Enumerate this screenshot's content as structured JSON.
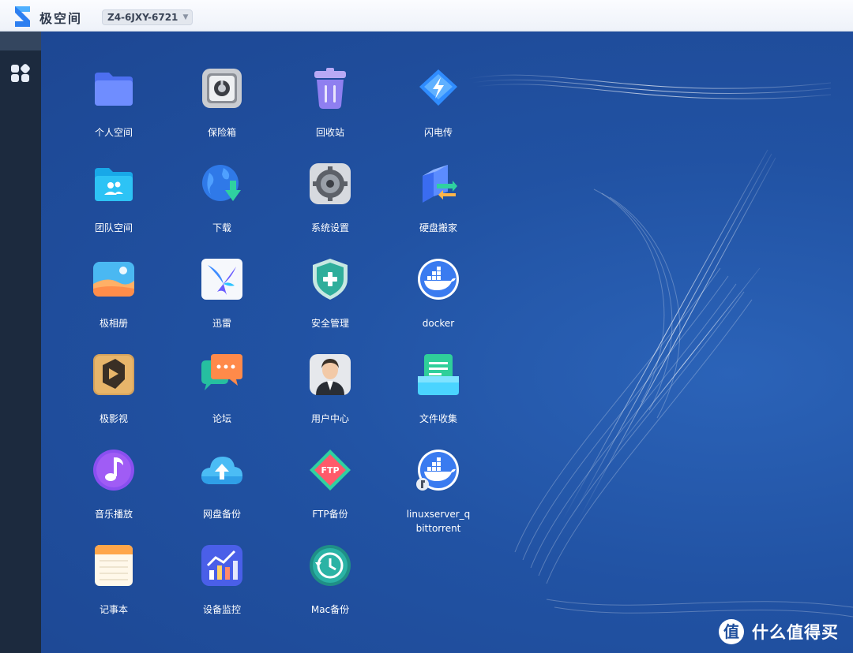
{
  "header": {
    "brand": "极空间",
    "device": "Z4-6JXY-6721"
  },
  "apps": [
    {
      "label": "个人空间",
      "icon": "folder-icon"
    },
    {
      "label": "保险箱",
      "icon": "safe-icon"
    },
    {
      "label": "回收站",
      "icon": "trash-icon"
    },
    {
      "label": "闪电传",
      "icon": "lightning-icon"
    },
    {
      "label": "团队空间",
      "icon": "team-folder-icon"
    },
    {
      "label": "下载",
      "icon": "download-globe-icon"
    },
    {
      "label": "系统设置",
      "icon": "settings-gear-icon"
    },
    {
      "label": "硬盘搬家",
      "icon": "disk-migrate-icon"
    },
    {
      "label": "极相册",
      "icon": "photo-album-icon"
    },
    {
      "label": "迅雷",
      "icon": "xunlei-bird-icon"
    },
    {
      "label": "安全管理",
      "icon": "shield-plus-icon"
    },
    {
      "label": "docker",
      "icon": "docker-whale-icon"
    },
    {
      "label": "极影视",
      "icon": "video-icon"
    },
    {
      "label": "论坛",
      "icon": "chat-bubbles-icon"
    },
    {
      "label": "用户中心",
      "icon": "user-avatar-icon"
    },
    {
      "label": "文件收集",
      "icon": "file-collect-icon"
    },
    {
      "label": "音乐播放",
      "icon": "music-note-icon"
    },
    {
      "label": "网盘备份",
      "icon": "cloud-upload-icon"
    },
    {
      "label": "FTP备份",
      "icon": "ftp-diamond-icon"
    },
    {
      "label": "linuxserver_q\nbittorrent",
      "line1": "linuxserver_q",
      "line2": "bittorrent",
      "icon": "docker-whale-icon"
    },
    {
      "label": "记事本",
      "icon": "notepad-icon"
    },
    {
      "label": "设备监控",
      "icon": "chart-monitor-icon"
    },
    {
      "label": "Mac备份",
      "icon": "time-machine-icon"
    }
  ],
  "watermark": {
    "logo": "值",
    "text": "什么值得买"
  },
  "colors": {
    "desktop": "#2357a6",
    "sidebar": "#1c2a3e",
    "topbar": "#f4f6fb"
  }
}
